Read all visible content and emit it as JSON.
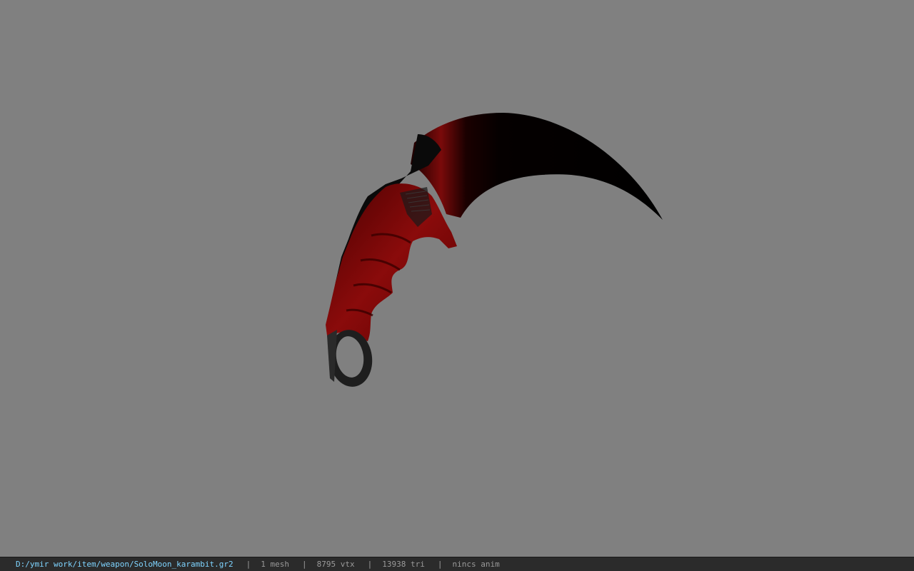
{
  "viewer": {
    "background_color": "#808080",
    "model_icon": "karambit-knife-model"
  },
  "status_bar": {
    "file_path": "D:/ymir work/item/weapon/SoloMoon_karambit.gr2",
    "separator": "|",
    "mesh_count": "1 mesh",
    "vertex_count": "8795 vtx",
    "triangle_count": "13938 tri",
    "animation": "nincs anim",
    "path_color": "#7fd4ff",
    "text_color": "#9a9a9a"
  }
}
